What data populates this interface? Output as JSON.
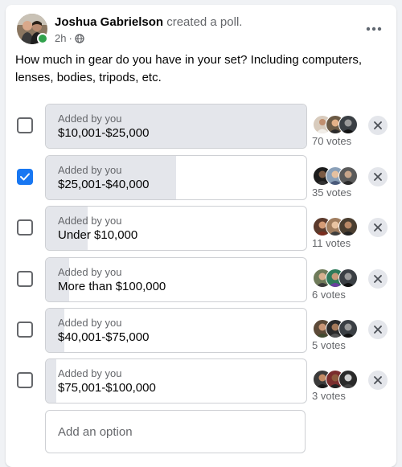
{
  "post": {
    "author": "Joshua Gabrielson",
    "action": "created a poll.",
    "time": "2h",
    "separator": "·",
    "audience_icon": "globe-icon",
    "text": "How much in gear do you have in your set? Including computers, lenses, bodies, tripods, etc."
  },
  "poll": {
    "options": [
      {
        "added_by": "Added by you",
        "label": "$10,001-$25,000",
        "votes": "70 votes",
        "checked": false,
        "fill_percent": 100
      },
      {
        "added_by": "Added by you",
        "label": "$25,001-$40,000",
        "votes": "35 votes",
        "checked": true,
        "fill_percent": 50
      },
      {
        "added_by": "Added by you",
        "label": "Under $10,000",
        "votes": "11 votes",
        "checked": false,
        "fill_percent": 16
      },
      {
        "added_by": "Added by you",
        "label": "More than $100,000",
        "votes": "6 votes",
        "checked": false,
        "fill_percent": 9
      },
      {
        "added_by": "Added by you",
        "label": "$40,001-$75,000",
        "votes": "5 votes",
        "checked": false,
        "fill_percent": 7
      },
      {
        "added_by": "Added by you",
        "label": "$75,001-$100,000",
        "votes": "3 votes",
        "checked": false,
        "fill_percent": 4
      }
    ],
    "add_option_placeholder": "Add an option"
  },
  "icons": {
    "more": "more-horizontal-icon",
    "remove": "close-icon",
    "check": "checkmark-icon",
    "online": "online-status-icon"
  },
  "colors": {
    "accent": "#1877f2",
    "online": "#31a24c",
    "fill": "#e4e6eb",
    "secondary_text": "#65676b"
  }
}
